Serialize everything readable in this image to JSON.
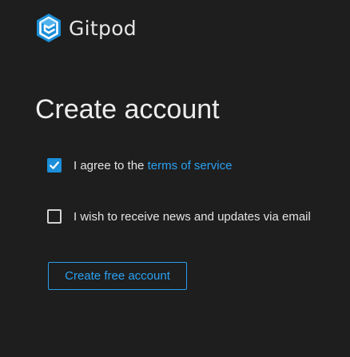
{
  "brand": {
    "name": "Gitpod",
    "icon": "gitpod-logo-icon",
    "color": "#1b8fd9"
  },
  "page": {
    "title": "Create account"
  },
  "terms": {
    "checked": true,
    "label_prefix": "I agree to the ",
    "link_text": "terms of service"
  },
  "newsletter": {
    "checked": false,
    "label": "I wish to receive news and updates via email"
  },
  "actions": {
    "create_label": "Create free account"
  },
  "colors": {
    "background": "#1e1e1e",
    "accent": "#2aa1f2",
    "text": "#e4e4e4"
  }
}
